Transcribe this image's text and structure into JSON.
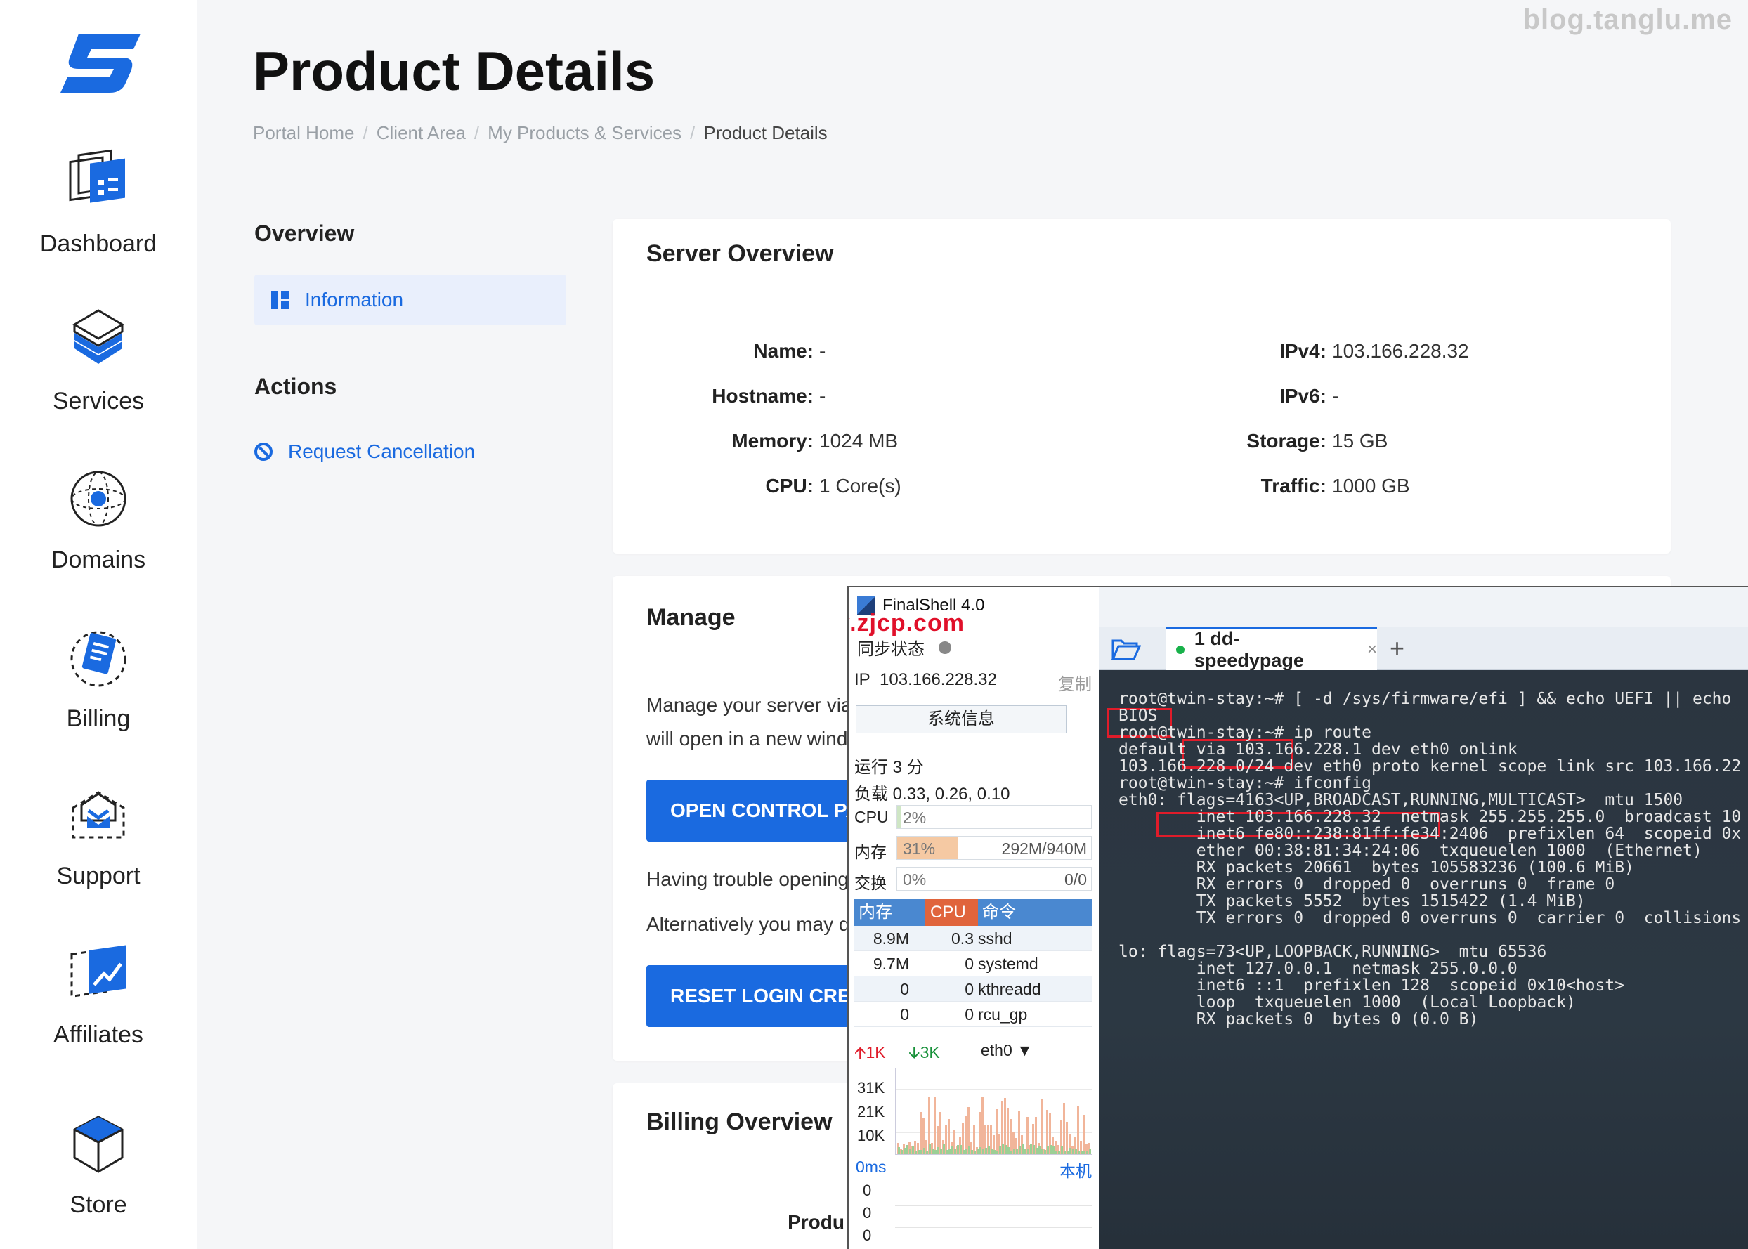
{
  "watermark": "blog.tanglu.me",
  "sidebar": {
    "items": [
      {
        "label": "Dashboard",
        "icon": "dashboard-icon"
      },
      {
        "label": "Services",
        "icon": "services-icon"
      },
      {
        "label": "Domains",
        "icon": "domains-icon"
      },
      {
        "label": "Billing",
        "icon": "billing-icon"
      },
      {
        "label": "Support",
        "icon": "support-icon"
      },
      {
        "label": "Affiliates",
        "icon": "affiliates-icon"
      },
      {
        "label": "Store",
        "icon": "store-icon"
      }
    ]
  },
  "page": {
    "title": "Product Details",
    "breadcrumb": [
      "Portal Home",
      "Client Area",
      "My Products & Services",
      "Product Details"
    ]
  },
  "overview": {
    "heading": "Overview",
    "tab": "Information",
    "actions_heading": "Actions",
    "cancel": "Request Cancellation"
  },
  "server": {
    "heading": "Server Overview",
    "left": [
      {
        "k": "Name:",
        "v": "-"
      },
      {
        "k": "Hostname:",
        "v": "-"
      },
      {
        "k": "Memory:",
        "v": "1024 MB"
      },
      {
        "k": "CPU:",
        "v": "1 Core(s)"
      }
    ],
    "right": [
      {
        "k": "IPv4:",
        "v": "103.166.228.32"
      },
      {
        "k": "IPv6:",
        "v": "-"
      },
      {
        "k": "Storage:",
        "v": "15 GB"
      },
      {
        "k": "Traffic:",
        "v": "1000 GB"
      }
    ]
  },
  "manage": {
    "heading": "Manage",
    "text1": "Manage your server via",
    "text2": "will open in a new wind",
    "btn1": "OPEN CONTROL PA",
    "text3": "Having trouble opening",
    "text4": "Alternatively you may d",
    "btn2": "RESET LOGIN CRED"
  },
  "billing": {
    "heading": "Billing Overview",
    "product": "Produ"
  },
  "finalshell": {
    "title": "FinalShell 4.0",
    "overlay": "www.zjcp.com",
    "sync": "同步状态",
    "ip_label": "IP",
    "ip": "103.166.228.32",
    "copy": "复制",
    "sysinfo": "系统信息",
    "uptime": "运行 3 分",
    "load": "负载 0.33, 0.26, 0.10",
    "cpu": {
      "label": "CPU",
      "pct": "2%",
      "value": 0.02
    },
    "mem": {
      "label": "内存",
      "pct": "31%",
      "value": 0.31,
      "detail": "292M/940M"
    },
    "swap": {
      "label": "交换",
      "pct": "0%",
      "value": 0.0,
      "detail": "0/0"
    },
    "proc_head": [
      "内存",
      "CPU",
      "命令"
    ],
    "procs": [
      {
        "mem": "8.9M",
        "cpu": "0.3",
        "cmd": "sshd"
      },
      {
        "mem": "9.7M",
        "cpu": "0",
        "cmd": "systemd"
      },
      {
        "mem": "0",
        "cpu": "0",
        "cmd": "kthreadd"
      },
      {
        "mem": "0",
        "cpu": "0",
        "cmd": "rcu_gp"
      }
    ],
    "net_up": "1K",
    "net_down": "3K",
    "iface": "eth0",
    "yticks": [
      "31K",
      "21K",
      "10K"
    ],
    "latency": "0ms",
    "host": "本机",
    "lat_ticks": [
      "0",
      "0",
      "0"
    ],
    "tab": "1 dd-speedypage",
    "tab_close": "×",
    "tab_add": "+",
    "colors": {
      "up": "#e01c2a",
      "down": "#18913a",
      "bar_header": "#4a88d0",
      "mem_fill": "#f5c9a3"
    }
  },
  "terminal": {
    "lines": [
      "root@twin-stay:~# [ -d /sys/firmware/efi ] && echo UEFI || echo",
      "BIOS",
      "root@twin-stay:~# ip route",
      "default via 103.166.228.1 dev eth0 onlink",
      "103.166.228.0/24 dev eth0 proto kernel scope link src 103.166.22",
      "root@twin-stay:~# ifconfig",
      "eth0: flags=4163<UP,BROADCAST,RUNNING,MULTICAST>  mtu 1500",
      "        inet 103.166.228.32  netmask 255.255.255.0  broadcast 10",
      "        inet6 fe80::238:81ff:fe34:2406  prefixlen 64  scopeid 0x",
      "        ether 00:38:81:34:24:06  txqueuelen 1000  (Ethernet)",
      "        RX packets 20661  bytes 105583236 (100.6 MiB)",
      "        RX errors 0  dropped 0  overruns 0  frame 0",
      "        TX packets 5552  bytes 1515422 (1.4 MiB)",
      "        TX errors 0  dropped 0 overruns 0  carrier 0  collisions",
      "",
      "lo: flags=73<UP,LOOPBACK,RUNNING>  mtu 65536",
      "        inet 127.0.0.1  netmask 255.0.0.0",
      "        inet6 ::1  prefixlen 128  scopeid 0x10<host>",
      "        loop  txqueuelen 1000  (Local Loopback)",
      "        RX packets 0  bytes 0 (0.0 B)"
    ]
  }
}
